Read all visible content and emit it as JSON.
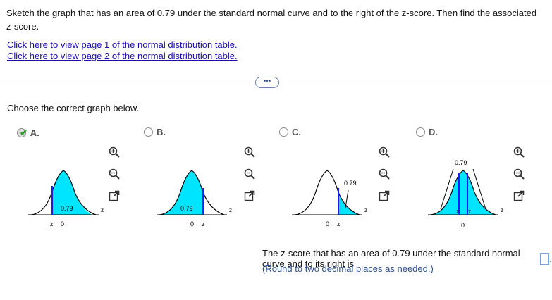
{
  "question": "Sketch the graph that has an area of 0.79 under the standard normal curve and to the right of the z-score. Then find the associated z-score.",
  "links": [
    "Click here to view page 1 of the normal distribution table.",
    "Click here to view page 2 of the normal distribution table."
  ],
  "more_button": "•••",
  "choose_label": "Choose the correct graph below.",
  "options": [
    {
      "letter": "A.",
      "selected": true
    },
    {
      "letter": "B.",
      "selected": false
    },
    {
      "letter": "C.",
      "selected": false
    },
    {
      "letter": "D.",
      "selected": false
    }
  ],
  "graphs": {
    "a": {
      "area": "0.79",
      "z": "z",
      "zero": "0",
      "axis": "z"
    },
    "b": {
      "area": "0.79",
      "z": "z",
      "zero": "0",
      "axis": "z"
    },
    "c": {
      "area": "0.79",
      "z": "z",
      "zero": "0",
      "axis": "z"
    },
    "d": {
      "area": "0.79",
      "z1": "z",
      "z2": "z",
      "zero": "0",
      "axis": "z"
    }
  },
  "answer_prompt": "The z-score that has an area of 0.79 under the standard normal curve and to its right is",
  "answer_suffix": ".",
  "hint": "(Round to two decimal places as needed.)",
  "colors": {
    "shade": "#00e5ff",
    "line": "#1a1aff",
    "link": "#1a0dab",
    "check": "#2e9e2e"
  },
  "icons": [
    "zoom-in-icon",
    "zoom-out-icon",
    "expand-icon"
  ]
}
